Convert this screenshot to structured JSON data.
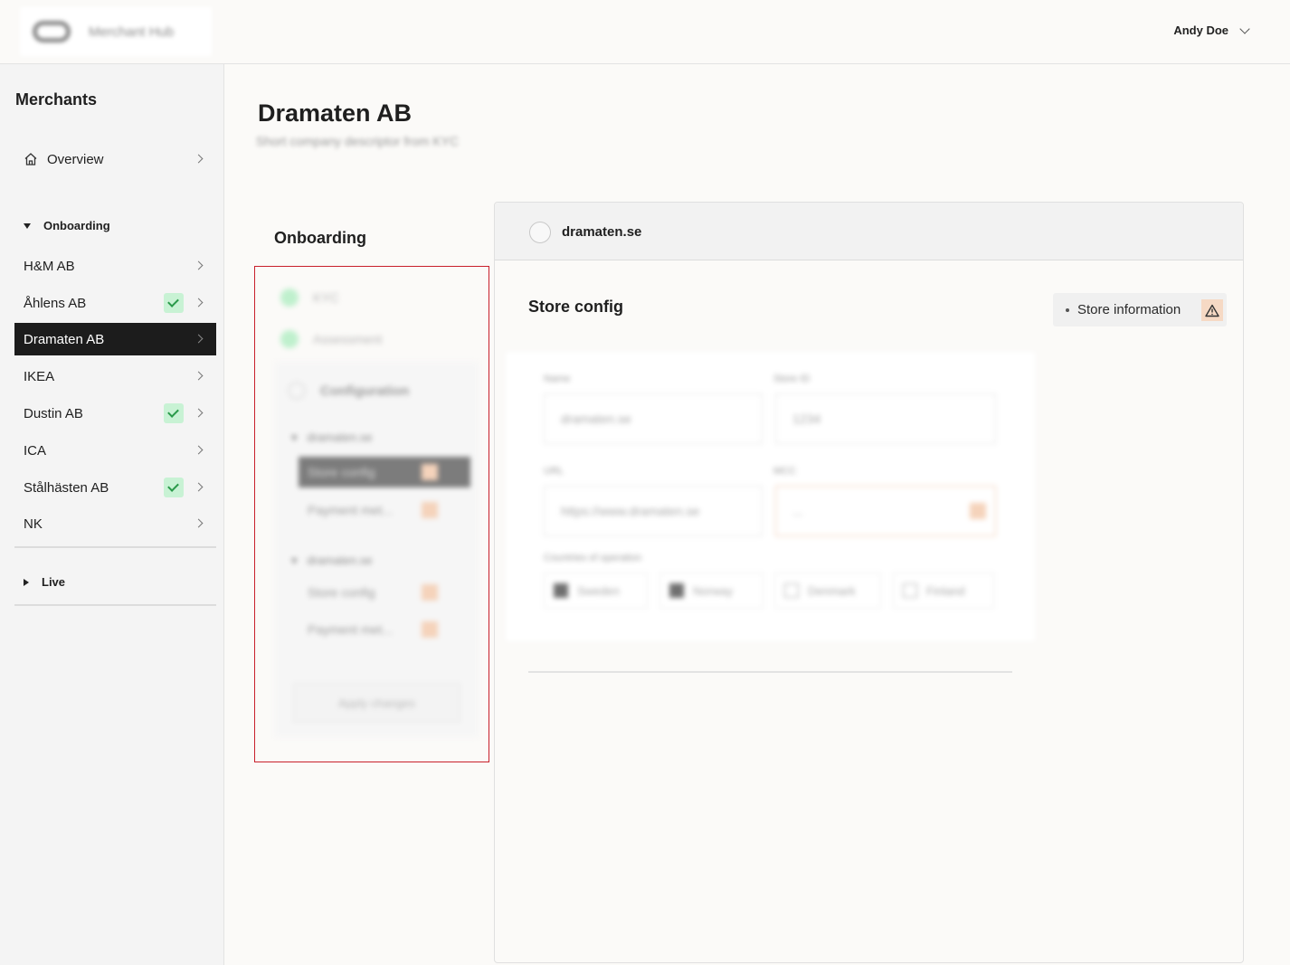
{
  "header": {
    "brand_name": "Merchant Hub",
    "user_name": "Andy Doe"
  },
  "sidebar": {
    "title": "Merchants",
    "overview_label": "Overview",
    "onboarding_label": "Onboarding",
    "live_label": "Live",
    "items": [
      {
        "label": "H&M AB",
        "verified": false
      },
      {
        "label": "Åhlens AB",
        "verified": true
      },
      {
        "label": "Dramaten AB",
        "verified": false,
        "active": true
      },
      {
        "label": "IKEA",
        "verified": false
      },
      {
        "label": "Dustin AB",
        "verified": true
      },
      {
        "label": "ICA",
        "verified": false
      },
      {
        "label": "Stålhästen AB",
        "verified": true
      },
      {
        "label": "NK",
        "verified": false
      }
    ]
  },
  "main": {
    "title": "Dramaten AB",
    "subtitle": "Short company descriptor from KYC",
    "onboarding_label": "Onboarding",
    "steps": [
      "KYC",
      "Assessment"
    ],
    "configuration": {
      "title": "Configuration",
      "groups": [
        {
          "domain": "dramaten.se",
          "rows": [
            "Store config",
            "Payment met..."
          ]
        },
        {
          "domain": "dramaten.se",
          "rows": [
            "Store config",
            "Payment met..."
          ]
        }
      ],
      "apply_label": "Apply changes"
    }
  },
  "panel": {
    "domain": "dramaten.se",
    "title": "Store config",
    "store_info_label": "Store information",
    "form": {
      "name_label": "Name",
      "name_value": "dramaten.se",
      "store_id_label": "Store ID",
      "store_id_value": "1234",
      "url_label": "URL",
      "url_value": "https://www.dramaten.se",
      "mcc_label": "MCC",
      "mcc_value": "...",
      "countries_label": "Countries of operation",
      "countries": [
        {
          "label": "Sweden",
          "checked": true
        },
        {
          "label": "Norway",
          "checked": true
        },
        {
          "label": "Denmark",
          "checked": false
        },
        {
          "label": "Finland",
          "checked": false
        }
      ]
    }
  },
  "colors": {
    "active_bg": "#1c1c1c",
    "check_bg": "#c8f2d4",
    "warning_bg": "#f6d9c4",
    "highlight_border": "#c8202b"
  }
}
